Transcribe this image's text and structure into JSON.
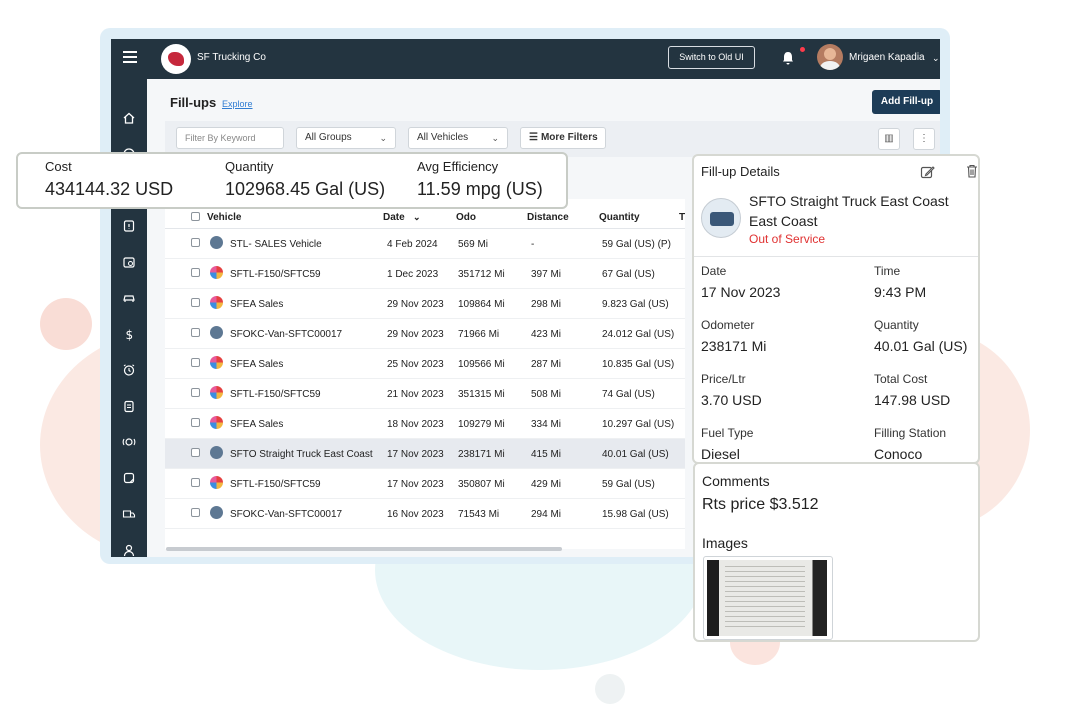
{
  "topbar": {
    "company": "SF Trucking Co",
    "switch_label": "Switch to Old UI",
    "user_name": "Mrigaen Kapadia"
  },
  "page": {
    "title": "Fill-ups",
    "explore": "Explore",
    "add_button": "Add Fill-up"
  },
  "filters": {
    "keyword_placeholder": "Filter By Keyword",
    "groups": "All Groups",
    "vehicles": "All Vehicles",
    "more": "More Filters"
  },
  "summary": {
    "cost_label": "Cost",
    "cost_value": "434144.32 USD",
    "quantity_label": "Quantity",
    "quantity_value": "102968.45 Gal (US)",
    "efficiency_label": "Avg Efficiency",
    "efficiency_value": "11.59 mpg (US)"
  },
  "table": {
    "columns": [
      "Vehicle",
      "Date",
      "Odo",
      "Distance",
      "Quantity",
      "T"
    ],
    "rows": [
      {
        "vehicle": "STL- SALES Vehicle",
        "date": "4 Feb 2024",
        "odo": "569 Mi",
        "distance": "-",
        "quantity": "59 Gal (US) (P)",
        "icon": "blue"
      },
      {
        "vehicle": "SFTL-F150/SFTC59",
        "date": "1 Dec 2023",
        "odo": "351712 Mi",
        "distance": "397 Mi",
        "quantity": "67 Gal (US)",
        "icon": "multi"
      },
      {
        "vehicle": "SFEA Sales",
        "date": "29 Nov 2023",
        "odo": "109864 Mi",
        "distance": "298 Mi",
        "quantity": "9.823 Gal (US)",
        "icon": "multi"
      },
      {
        "vehicle": "SFOKC-Van-SFTC00017",
        "date": "29 Nov 2023",
        "odo": "71966 Mi",
        "distance": "423 Mi",
        "quantity": "24.012 Gal (US)",
        "icon": "blue"
      },
      {
        "vehicle": "SFEA Sales",
        "date": "25 Nov 2023",
        "odo": "109566 Mi",
        "distance": "287 Mi",
        "quantity": "10.835 Gal (US)",
        "icon": "multi"
      },
      {
        "vehicle": "SFTL-F150/SFTC59",
        "date": "21 Nov 2023",
        "odo": "351315 Mi",
        "distance": "508 Mi",
        "quantity": "74 Gal (US)",
        "icon": "multi"
      },
      {
        "vehicle": "SFEA Sales",
        "date": "18 Nov 2023",
        "odo": "109279 Mi",
        "distance": "334 Mi",
        "quantity": "10.297 Gal (US)",
        "icon": "multi"
      },
      {
        "vehicle": "SFTO Straight Truck East Coast",
        "date": "17 Nov 2023",
        "odo": "238171 Mi",
        "distance": "415 Mi",
        "quantity": "40.01 Gal (US)",
        "icon": "blue",
        "selected": true
      },
      {
        "vehicle": "SFTL-F150/SFTC59",
        "date": "17 Nov 2023",
        "odo": "350807 Mi",
        "distance": "429 Mi",
        "quantity": "59 Gal (US)",
        "icon": "multi"
      },
      {
        "vehicle": "SFOKC-Van-SFTC00017",
        "date": "16 Nov 2023",
        "odo": "71543 Mi",
        "distance": "294 Mi",
        "quantity": "15.98 Gal (US)",
        "icon": "blue"
      }
    ]
  },
  "detail": {
    "title": "Fill-up Details",
    "vehicle_name": "SFTO Straight Truck East Coast",
    "vehicle_group": "East Coast",
    "status": "Out of Service",
    "fields": {
      "date_label": "Date",
      "date": "17 Nov 2023",
      "time_label": "Time",
      "time": "9:43 PM",
      "odometer_label": "Odometer",
      "odometer": "238171 Mi",
      "quantity_label": "Quantity",
      "quantity": "40.01 Gal (US)",
      "price_label": "Price/Ltr",
      "price": "3.70 USD",
      "total_label": "Total Cost",
      "total": "147.98 USD",
      "fuel_label": "Fuel Type",
      "fuel": "Diesel",
      "station_label": "Filling Station",
      "station": "Conoco"
    },
    "comments_label": "Comments",
    "comment": "Rts price $3.512",
    "images_label": "Images"
  },
  "colors": {
    "topbar": "#233440",
    "primary_button": "#1d3c57",
    "status_red": "#e03131",
    "link": "#2f7cd2"
  }
}
